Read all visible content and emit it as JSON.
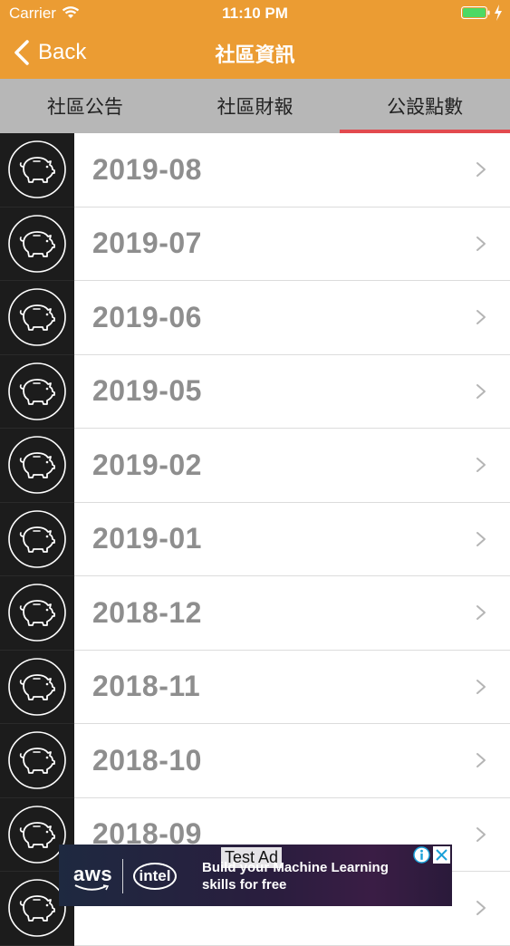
{
  "status_bar": {
    "carrier": "Carrier",
    "time": "11:10 PM"
  },
  "nav": {
    "back_label": "Back",
    "title": "社區資訊"
  },
  "tabs": [
    {
      "label": "社區公告",
      "active": false
    },
    {
      "label": "社區財報",
      "active": false
    },
    {
      "label": "公設點數",
      "active": true
    }
  ],
  "list": {
    "items": [
      {
        "label": "2019-08"
      },
      {
        "label": "2019-07"
      },
      {
        "label": "2019-06"
      },
      {
        "label": "2019-05"
      },
      {
        "label": "2019-02"
      },
      {
        "label": "2019-01"
      },
      {
        "label": "2018-12"
      },
      {
        "label": "2018-11"
      },
      {
        "label": "2018-10"
      },
      {
        "label": "2018-09"
      },
      {
        "label": ""
      }
    ],
    "icon": "piggy-bank-icon"
  },
  "ad": {
    "test_label": "Test Ad",
    "brand1": "aws",
    "brand2": "intel",
    "text": "Build your Machine Learning skills for free"
  },
  "colors": {
    "header": "#eb9c33",
    "tab_bg": "#b7b7b7",
    "tab_indicator": "#e24a4f",
    "icon_bg": "#1c1c1c",
    "item_text": "#8e8e8e"
  }
}
